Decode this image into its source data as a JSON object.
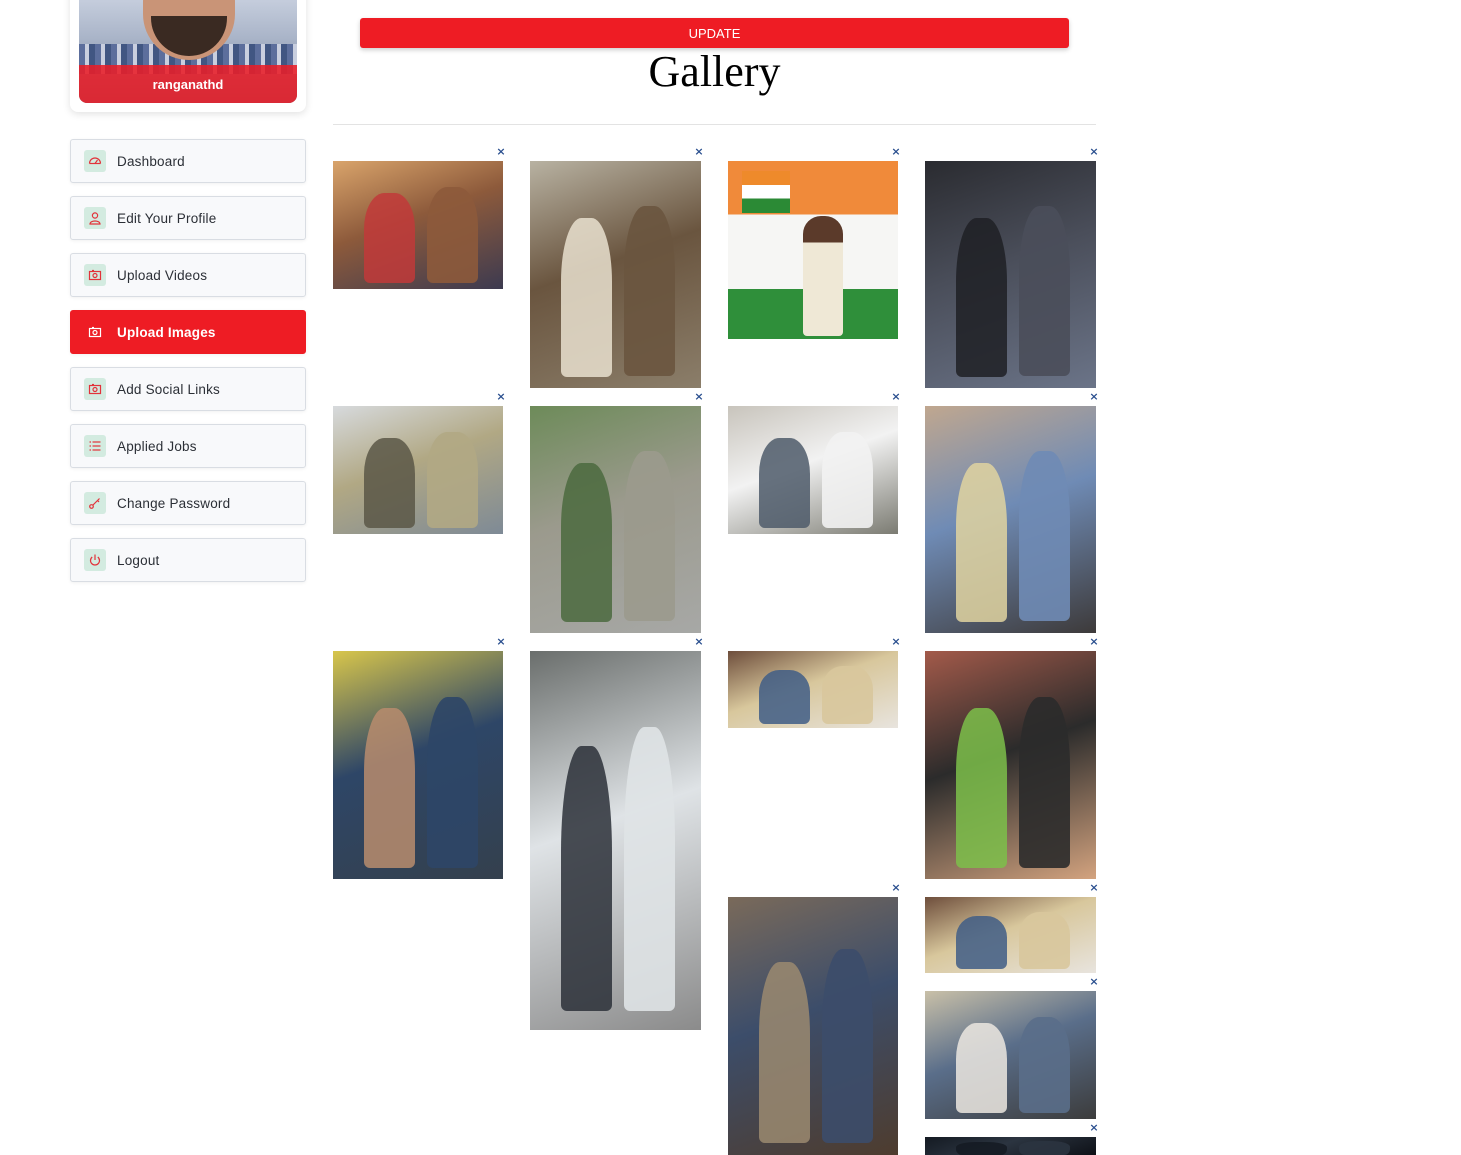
{
  "profile": {
    "username": "ranganathd"
  },
  "menu": [
    {
      "label": "Dashboard",
      "icon": "dashboard-icon",
      "active": false
    },
    {
      "label": "Edit Your Profile",
      "icon": "user-icon",
      "active": false
    },
    {
      "label": "Upload Videos",
      "icon": "camera-icon",
      "active": false
    },
    {
      "label": "Upload Images",
      "icon": "camera-icon",
      "active": true
    },
    {
      "label": "Add Social Links",
      "icon": "camera-icon",
      "active": false
    },
    {
      "label": "Applied Jobs",
      "icon": "list-icon",
      "active": false
    },
    {
      "label": "Change Password",
      "icon": "key-icon",
      "active": false
    },
    {
      "label": "Logout",
      "icon": "power-icon",
      "active": false
    }
  ],
  "main": {
    "update_label": "UPDATE",
    "gallery_title": "Gallery",
    "delete_glyph": "×"
  },
  "colors": {
    "accent": "#ee1c24",
    "icon_bg": "#d3ebe0",
    "delete": "#2a4f8f"
  }
}
